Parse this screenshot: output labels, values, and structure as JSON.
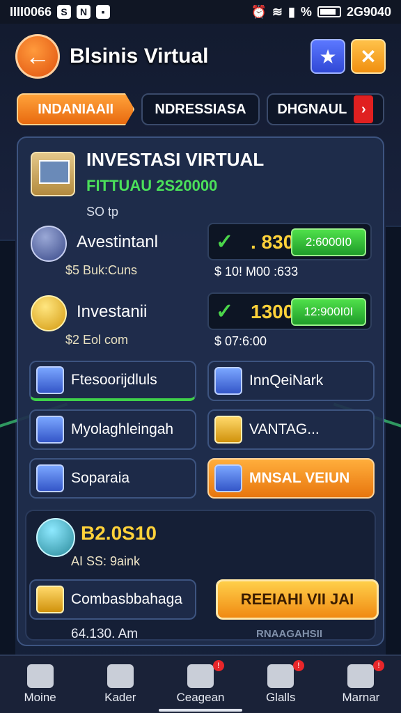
{
  "status": {
    "left": "IIII0066",
    "right_pct": "%",
    "time": "2G9040"
  },
  "header": {
    "title": "Blsinis Virtual",
    "back_glyph": "←",
    "star_glyph": "★",
    "close_glyph": "✕"
  },
  "tabs": [
    {
      "label": "INDANIAAII",
      "active": true
    },
    {
      "label": "NDRESSIASA",
      "active": false
    },
    {
      "label": "DHGNAUL",
      "active": false,
      "chevron": "›"
    }
  ],
  "investasi": {
    "title": "INVESTASI VIRTUAL",
    "subtitle": "FITTUAU 2S20000",
    "small": "SO tp"
  },
  "rows": [
    {
      "name": "Avestintanl",
      "sub": "$5 Buk:Cuns",
      "check": "✓",
      "value": ". 830",
      "button": "2:6000I0",
      "pill_sub": "$ 10! M00 :633"
    },
    {
      "name": "Investanii",
      "sub": "$2 Eol com",
      "check": "✓",
      "value": "1300",
      "button": "12:900I0I",
      "pill_sub": "$ 07:6:00"
    }
  ],
  "cards": {
    "c1": "Ftesoorijdluls",
    "c2": "InnQeiNark",
    "c3": "Myolaghleingah",
    "c4": "VANTAG...",
    "c5": "Soparaia",
    "c6": "MNSAL VEIUN"
  },
  "balance": {
    "amount": "B2.0S10",
    "sub": "AI SS: 9aink",
    "card": "Combasbbahaga",
    "cta": "REEIAHI VII JAI",
    "time": "64.130. Am",
    "right": "RNAAGAHSII"
  },
  "nav": [
    {
      "label": "Moine",
      "icon": "home-icon",
      "badge": ""
    },
    {
      "label": "Kader",
      "icon": "users-icon",
      "badge": ""
    },
    {
      "label": "Ceagean",
      "icon": "camera-icon",
      "badge": "!"
    },
    {
      "label": "Glalls",
      "icon": "trophy-icon",
      "badge": "!"
    },
    {
      "label": "Marnar",
      "icon": "profile-icon",
      "badge": "!"
    }
  ],
  "colors": {
    "accent": "#f08a12",
    "green": "#3fd04a",
    "gold": "#ffd23a",
    "panel": "#202e4c"
  }
}
